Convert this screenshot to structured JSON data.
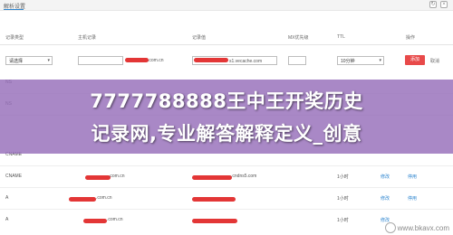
{
  "header": {
    "title": "解析设置"
  },
  "table": {
    "columns": [
      "记录类型",
      "主机记录",
      "记录值",
      "MX优先级",
      "TTL",
      "操作"
    ]
  },
  "form": {
    "type_select": "请选择",
    "host_suffix": ".com.cn",
    "value_suffix": "s1.vecache.com",
    "ttl_select": "10分钟",
    "add_label": "添加",
    "cancel_label": "取消"
  },
  "rows": [
    {
      "type": "NS",
      "host": "",
      "value": "",
      "ttl": "",
      "action": ""
    },
    {
      "type": "NS",
      "host": "",
      "value": "",
      "ttl": "",
      "action": ""
    },
    {
      "type": "CNAME",
      "host": ".com.cn",
      "value": ".cndns5.com",
      "ttl": "1小时",
      "action": "修改",
      "action2": "停用"
    },
    {
      "type": "A",
      "host": ".com.cn",
      "value": "",
      "ttl": "1小时",
      "action": "修改",
      "action2": "停用"
    },
    {
      "type": "A",
      "host": ".com.cn",
      "value": "",
      "ttl": "1小时",
      "action": "修改",
      "action2": ""
    }
  ],
  "overlay": {
    "line1": "7777788888王中王开奖历史",
    "line2": "记录网,专业解答解释定义_创意"
  },
  "watermark": {
    "text": "www.bkavx.com"
  },
  "colors": {
    "accent": "#2f86d0",
    "add_button": "#e84a4a",
    "redaction": "#e02020",
    "overlay": "#966eb9"
  }
}
